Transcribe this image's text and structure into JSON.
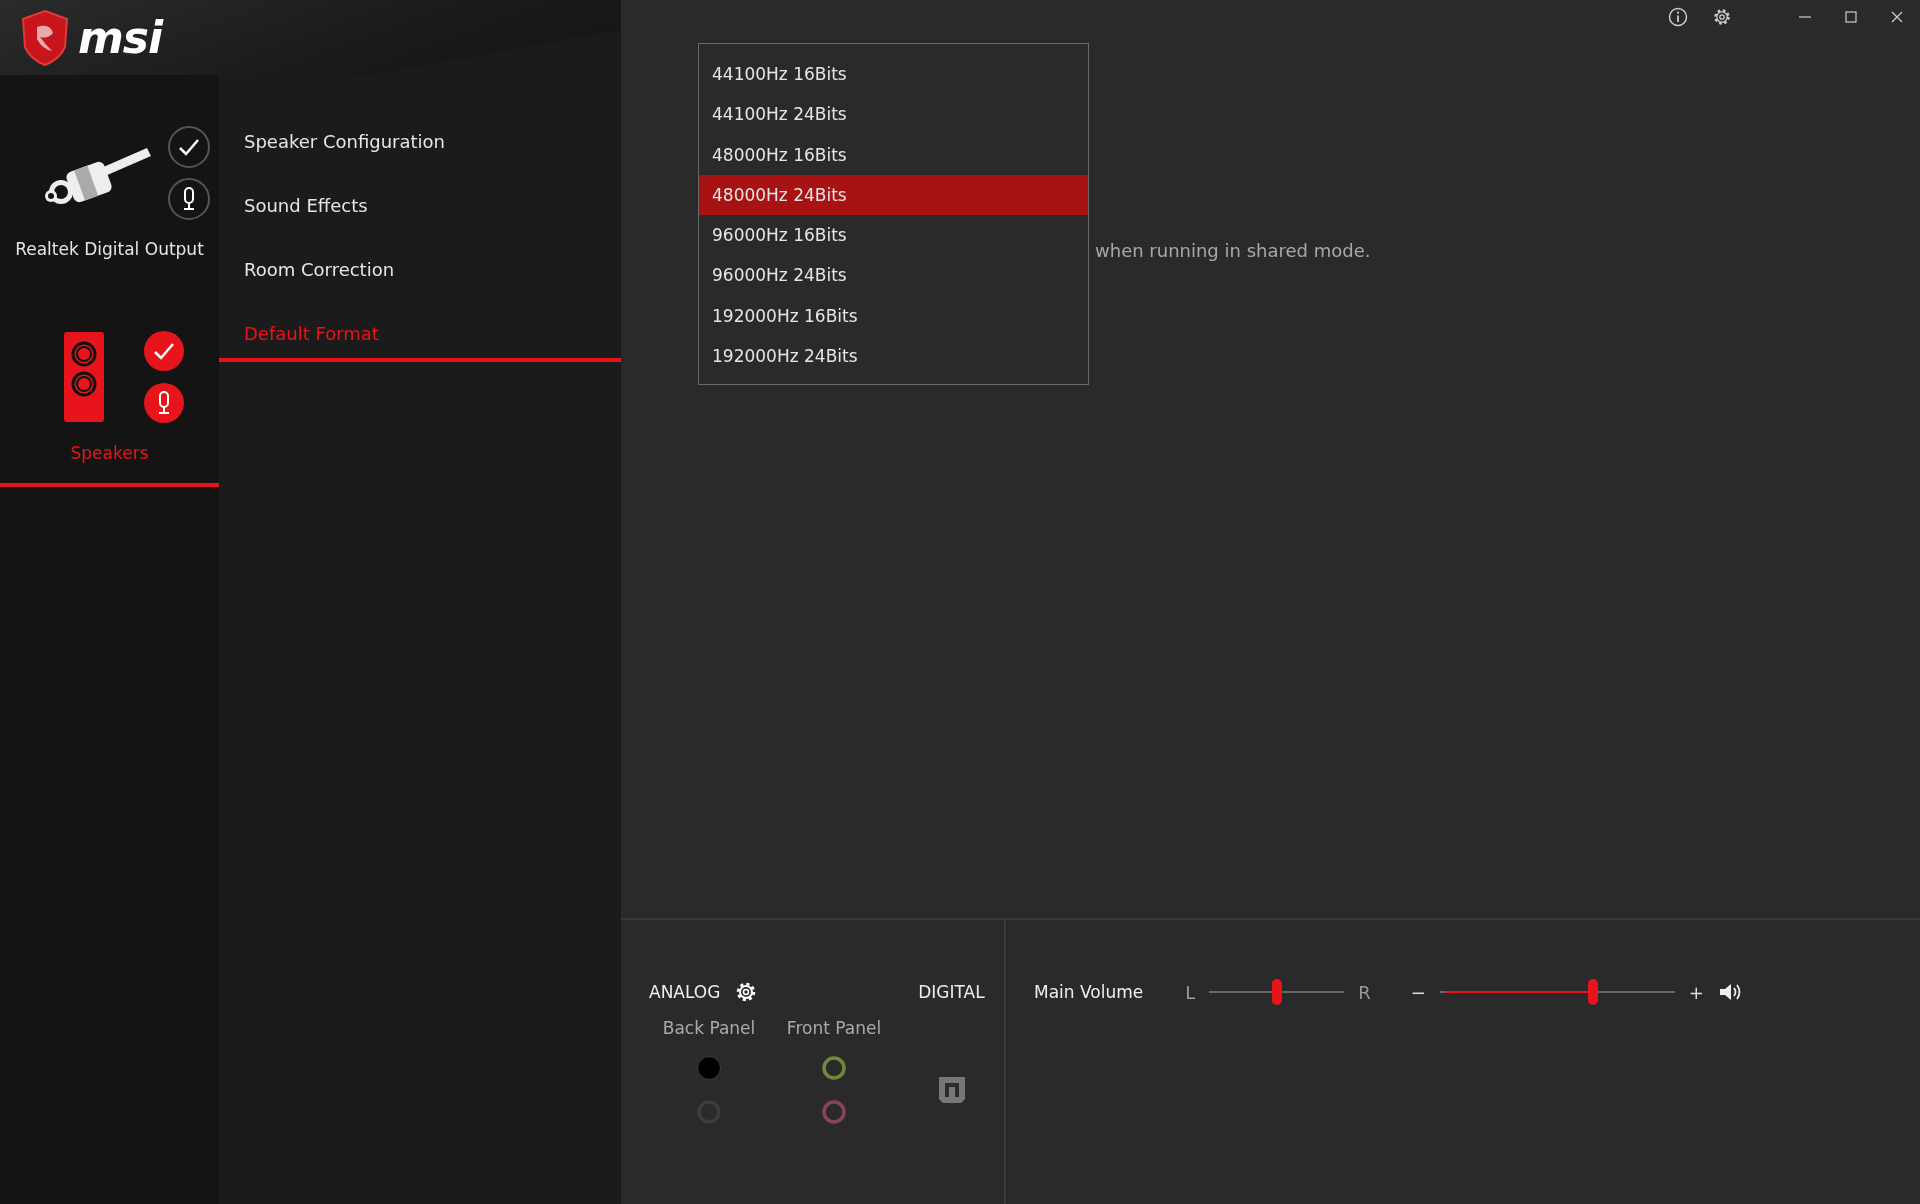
{
  "logo": "msi",
  "window_controls": [
    {
      "kind": "info"
    },
    {
      "kind": "settings"
    },
    {
      "kind": "minimize"
    },
    {
      "kind": "maximize"
    },
    {
      "kind": "close"
    }
  ],
  "devices": [
    {
      "name": "Realtek Digital Output",
      "kind": "digital",
      "selected": false
    },
    {
      "name": "Speakers",
      "kind": "speakers",
      "selected": true
    }
  ],
  "nav": [
    {
      "label": "Speaker Configuration",
      "selected": false
    },
    {
      "label": "Sound Effects",
      "selected": false
    },
    {
      "label": "Room Correction",
      "selected": false
    },
    {
      "label": "Default Format",
      "selected": true
    }
  ],
  "format_dropdown": {
    "options": [
      {
        "label": "44100Hz 16Bits",
        "selected": false
      },
      {
        "label": "44100Hz 24Bits",
        "selected": false
      },
      {
        "label": "48000Hz 16Bits",
        "selected": false
      },
      {
        "label": "48000Hz 24Bits",
        "selected": true
      },
      {
        "label": "96000Hz 16Bits",
        "selected": false
      },
      {
        "label": "96000Hz 24Bits",
        "selected": false
      },
      {
        "label": "192000Hz 16Bits",
        "selected": false
      },
      {
        "label": "192000Hz 24Bits",
        "selected": false
      }
    ]
  },
  "hint": "when running in shared mode.",
  "connectors": {
    "analog_label": "ANALOG",
    "digital_label": "DIGITAL",
    "panels": [
      {
        "label": "Back Panel",
        "jacks": [
          {
            "color": "#000000",
            "active": true
          },
          {
            "color": "#3c3c3c",
            "active": false
          }
        ]
      },
      {
        "label": "Front Panel",
        "jacks": [
          {
            "color": "#6f8a3a",
            "active": false
          },
          {
            "color": "#8a4458",
            "active": false
          }
        ]
      }
    ]
  },
  "volume": {
    "label": "Main Volume",
    "left": "L",
    "right": "R",
    "minus": "−",
    "plus": "+",
    "balance": {
      "level": 0.5
    },
    "main": {
      "level": 0.66
    }
  }
}
